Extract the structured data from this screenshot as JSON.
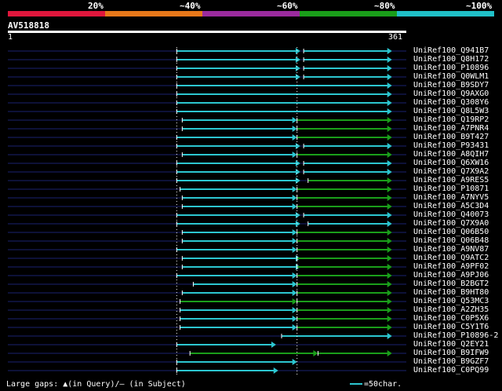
{
  "legend": {
    "labels": [
      "20%",
      "~40%",
      "~60%",
      "~80%",
      "~100%"
    ],
    "colors": [
      "#e0173c",
      "#e8781a",
      "#9b2b9e",
      "#1a9e1a",
      "#20c0c8"
    ]
  },
  "query": {
    "name": "AV518818",
    "start": "1",
    "end": "361",
    "length": 361
  },
  "colors": {
    "cyan": "#2cc6d0",
    "green": "#1a9e1a",
    "navy": "#1a2270",
    "white": "#ffffff"
  },
  "hits": [
    {
      "name": "UniRef100_Q941B7",
      "segs": [
        [
          153,
          265,
          "c"
        ],
        [
          268,
          348,
          "c"
        ]
      ]
    },
    {
      "name": "UniRef100_Q8H172",
      "segs": [
        [
          153,
          265,
          "c"
        ],
        [
          268,
          348,
          "c"
        ]
      ]
    },
    {
      "name": "UniRef100_P10896",
      "segs": [
        [
          153,
          265,
          "c"
        ],
        [
          268,
          348,
          "c"
        ]
      ]
    },
    {
      "name": "UniRef100_Q0WLM1",
      "segs": [
        [
          153,
          265,
          "c"
        ],
        [
          268,
          348,
          "c"
        ]
      ]
    },
    {
      "name": "UniRef100_B9SDY7",
      "segs": [
        [
          153,
          348,
          "c"
        ]
      ]
    },
    {
      "name": "UniRef100_Q9AXG0",
      "segs": [
        [
          153,
          348,
          "c"
        ]
      ]
    },
    {
      "name": "UniRef100_Q308Y6",
      "segs": [
        [
          153,
          348,
          "c"
        ]
      ]
    },
    {
      "name": "UniRef100_Q8L5W3",
      "segs": [
        [
          153,
          348,
          "c"
        ]
      ]
    },
    {
      "name": "UniRef100_Q19RP2",
      "segs": [
        [
          158,
          262,
          "c"
        ],
        [
          262,
          348,
          "g"
        ]
      ]
    },
    {
      "name": "UniRef100_A7PNR4",
      "segs": [
        [
          158,
          262,
          "c"
        ],
        [
          262,
          348,
          "g"
        ]
      ]
    },
    {
      "name": "UniRef100_B9T427",
      "segs": [
        [
          153,
          262,
          "c"
        ],
        [
          262,
          348,
          "g"
        ]
      ]
    },
    {
      "name": "UniRef100_P93431",
      "segs": [
        [
          153,
          265,
          "c"
        ],
        [
          268,
          348,
          "c"
        ]
      ]
    },
    {
      "name": "UniRef100_A8QIH7",
      "segs": [
        [
          158,
          262,
          "c"
        ],
        [
          262,
          348,
          "g"
        ]
      ]
    },
    {
      "name": "UniRef100_Q6XW16",
      "segs": [
        [
          153,
          265,
          "c"
        ],
        [
          268,
          348,
          "c"
        ]
      ]
    },
    {
      "name": "UniRef100_Q7X9A2",
      "segs": [
        [
          153,
          265,
          "c"
        ],
        [
          268,
          348,
          "c"
        ]
      ]
    },
    {
      "name": "UniRef100_A9RES5",
      "segs": [
        [
          153,
          265,
          "c"
        ],
        [
          272,
          348,
          "g"
        ]
      ]
    },
    {
      "name": "UniRef100_P10871",
      "segs": [
        [
          156,
          262,
          "c"
        ],
        [
          262,
          348,
          "g"
        ]
      ]
    },
    {
      "name": "UniRef100_A7NYV5",
      "segs": [
        [
          158,
          262,
          "c"
        ],
        [
          262,
          348,
          "g"
        ]
      ]
    },
    {
      "name": "UniRef100_A5C3D4",
      "segs": [
        [
          158,
          262,
          "c"
        ],
        [
          262,
          348,
          "g"
        ]
      ]
    },
    {
      "name": "UniRef100_Q40073",
      "segs": [
        [
          153,
          265,
          "c"
        ],
        [
          268,
          348,
          "c"
        ]
      ]
    },
    {
      "name": "UniRef100_Q7X9A0",
      "segs": [
        [
          153,
          265,
          "c"
        ],
        [
          272,
          348,
          "c"
        ]
      ]
    },
    {
      "name": "UniRef100_Q06B50",
      "segs": [
        [
          158,
          262,
          "c"
        ],
        [
          262,
          348,
          "g"
        ]
      ]
    },
    {
      "name": "UniRef100_Q06B48",
      "segs": [
        [
          158,
          262,
          "c"
        ],
        [
          262,
          348,
          "g"
        ]
      ]
    },
    {
      "name": "UniRef100_A9NV87",
      "segs": [
        [
          153,
          262,
          "c"
        ],
        [
          262,
          348,
          "g"
        ]
      ]
    },
    {
      "name": "UniRef100_Q9ATC2",
      "segs": [
        [
          158,
          265,
          "c"
        ],
        [
          262,
          348,
          "g"
        ]
      ]
    },
    {
      "name": "UniRef100_A9PF02",
      "segs": [
        [
          158,
          265,
          "c"
        ],
        [
          262,
          348,
          "g"
        ]
      ]
    },
    {
      "name": "UniRef100_A9PJ06",
      "segs": [
        [
          153,
          262,
          "c"
        ],
        [
          262,
          348,
          "g"
        ]
      ]
    },
    {
      "name": "UniRef100_B2BGT2",
      "segs": [
        [
          168,
          262,
          "c"
        ],
        [
          262,
          348,
          "g"
        ]
      ]
    },
    {
      "name": "UniRef100_B9HT80",
      "segs": [
        [
          158,
          262,
          "c"
        ],
        [
          262,
          348,
          "g"
        ]
      ]
    },
    {
      "name": "UniRef100_Q53MC3",
      "segs": [
        [
          156,
          262,
          "g"
        ],
        [
          262,
          348,
          "g"
        ]
      ]
    },
    {
      "name": "UniRef100_A2ZH35",
      "segs": [
        [
          156,
          262,
          "c"
        ],
        [
          262,
          348,
          "g"
        ]
      ]
    },
    {
      "name": "UniRef100_C0P5X6",
      "segs": [
        [
          156,
          262,
          "c"
        ],
        [
          262,
          348,
          "g"
        ]
      ]
    },
    {
      "name": "UniRef100_C5Y1T6",
      "segs": [
        [
          156,
          262,
          "c"
        ],
        [
          262,
          348,
          "g"
        ]
      ]
    },
    {
      "name": "UniRef100_P10896-2",
      "segs": [
        [
          248,
          348,
          "c"
        ]
      ]
    },
    {
      "name": "UniRef100_Q2EY21",
      "segs": [
        [
          153,
          243,
          "c"
        ]
      ]
    },
    {
      "name": "UniRef100_B9IFW9",
      "segs": [
        [
          165,
          281,
          "g"
        ],
        [
          281,
          348,
          "g"
        ]
      ]
    },
    {
      "name": "UniRef100_B9GZF7",
      "segs": [
        [
          153,
          262,
          "c"
        ]
      ]
    },
    {
      "name": "UniRef100_C0PQ99",
      "segs": [
        [
          153,
          245,
          "c"
        ]
      ]
    }
  ],
  "footer": {
    "gaps_note": "Large gaps: ▲(in Query)/— (in Subject)",
    "scale_key": "=50char."
  }
}
